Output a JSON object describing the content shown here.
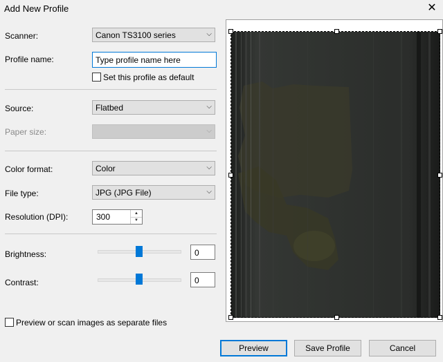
{
  "window": {
    "title": "Add New Profile"
  },
  "form": {
    "scanner": {
      "label": "Scanner:",
      "value": "Canon TS3100 series"
    },
    "profile_name": {
      "label": "Profile name:",
      "placeholder": "Type profile name here"
    },
    "set_default": {
      "label": "Set this profile as default",
      "checked": false
    },
    "source": {
      "label": "Source:",
      "value": "Flatbed"
    },
    "paper_size": {
      "label": "Paper size:",
      "value": "",
      "disabled": true
    },
    "color_format": {
      "label": "Color format:",
      "value": "Color"
    },
    "file_type": {
      "label": "File type:",
      "value": "JPG (JPG File)"
    },
    "resolution": {
      "label": "Resolution (DPI):",
      "value": "300"
    },
    "brightness": {
      "label": "Brightness:",
      "value": "0",
      "slider_fraction": 0.5
    },
    "contrast": {
      "label": "Contrast:",
      "value": "0",
      "slider_fraction": 0.5
    },
    "separate_files": {
      "label": "Preview or scan images as separate files",
      "checked": false
    }
  },
  "buttons": {
    "preview": "Preview",
    "save": "Save Profile",
    "cancel": "Cancel"
  },
  "icons": {
    "close": "close-icon",
    "dropdown": "chevron-down-icon"
  },
  "colors": {
    "accent": "#0078d7",
    "background": "#f0f0f0"
  }
}
